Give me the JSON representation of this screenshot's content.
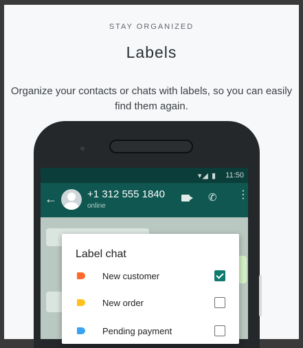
{
  "header": {
    "eyebrow": "STAY ORGANIZED",
    "title": "Labels",
    "description": "Organize your contacts or chats with labels, so you can easily find them again."
  },
  "phone": {
    "status_time": "11:50",
    "status_icons": "▾◢ ▮",
    "contact_name": "+1 312 555 1840",
    "contact_status": "online"
  },
  "dialog": {
    "title": "Label chat",
    "labels": [
      {
        "text": "New customer",
        "color": "#ff6a2c",
        "checked": true
      },
      {
        "text": "New order",
        "color": "#ffc21c",
        "checked": false
      },
      {
        "text": "Pending payment",
        "color": "#3aa3f0",
        "checked": false
      }
    ]
  },
  "colors": {
    "appbar": "#0f5750",
    "statusbar": "#0b3e3a",
    "check_accent": "#0f7a6e"
  }
}
